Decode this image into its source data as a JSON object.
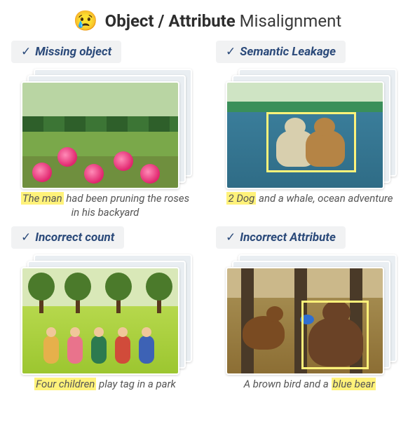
{
  "header": {
    "emoji": "😢",
    "title_strong": "Object / Attribute",
    "title_rest": " Misalignment"
  },
  "cells": [
    {
      "check": "✓",
      "label": "Missing object",
      "caption_pre": "",
      "caption_hl": "The man",
      "caption_post": " had been pruning the roses in his backyard"
    },
    {
      "check": "✓",
      "label": "Semantic Leakage",
      "caption_pre": "",
      "caption_hl": "2 Dog",
      "caption_post": " and a whale, ocean adventure"
    },
    {
      "check": "✓",
      "label": "Incorrect count",
      "caption_pre": "",
      "caption_hl": "Four children",
      "caption_post": " play tag in a park"
    },
    {
      "check": "✓",
      "label": "Incorrect Attribute",
      "caption_pre": "A brown bird and a ",
      "caption_hl": "blue bear",
      "caption_post": ""
    }
  ]
}
